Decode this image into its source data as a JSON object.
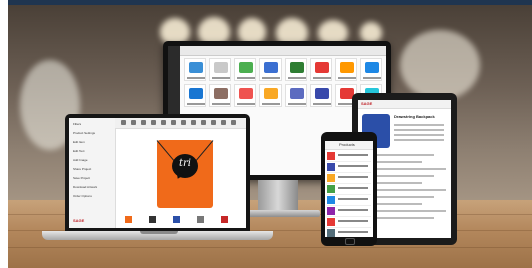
{
  "scene": {
    "colors": {
      "top_bar": "#1f3550",
      "brand_red": "#c0242a",
      "bag_orange": "#f06a1a",
      "table_wood": "#b3875c"
    }
  },
  "laptop": {
    "bag_logo": "tri",
    "sidebar_items": [
      {
        "label": "Filters",
        "icon": "list-icon"
      },
      {
        "label": "Product Settings",
        "icon": "gear-icon"
      },
      {
        "label": "Edit Item",
        "icon": "edit-icon"
      },
      {
        "label": "Edit Text",
        "icon": "text-icon"
      },
      {
        "label": "Add Image",
        "icon": "image-icon"
      },
      {
        "label": "Share Project",
        "icon": "share-icon"
      },
      {
        "label": "Save Project",
        "icon": "save-icon"
      },
      {
        "label": "Download Artwork",
        "icon": "download-icon"
      },
      {
        "label": "Order Options",
        "icon": "cart-icon"
      }
    ],
    "brand": "SAGE"
  },
  "tablet": {
    "header_label": "SAGE",
    "product_title": "Drawstring Backpack"
  },
  "phone": {
    "header_label": "Products"
  }
}
